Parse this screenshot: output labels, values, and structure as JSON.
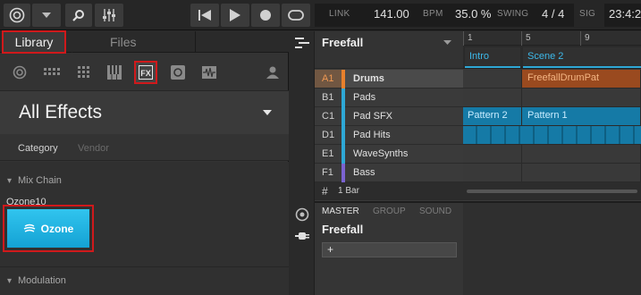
{
  "topbar": {
    "link_label": "LINK",
    "tempo": "141.00",
    "tempo_unit": "BPM",
    "swing": "35.0 %",
    "swing_label": "SWING",
    "signature": "4 / 4",
    "sig_label": "SIG",
    "position": "23:4:2"
  },
  "browser": {
    "tab_library": "Library",
    "tab_files": "Files",
    "selected_type": "All Effects",
    "category_label": "Category",
    "vendor_label": "Vendor",
    "section_mixchain": "Mix Chain",
    "plugin_label": "Ozone10",
    "plugin_tile": "Ozone",
    "section_modulation": "Modulation"
  },
  "arranger": {
    "project": "Freefall",
    "ruler": [
      "1",
      "5",
      "9"
    ],
    "scenes": [
      "Intro",
      "Scene 2"
    ],
    "groups": [
      {
        "letter": "A1",
        "name": "Drums",
        "color": "#e8802c"
      },
      {
        "letter": "B1",
        "name": "Pads",
        "color": "#2ea8d6"
      },
      {
        "letter": "C1",
        "name": "Pad SFX",
        "color": "#2ea8d6"
      },
      {
        "letter": "D1",
        "name": "Pad Hits",
        "color": "#2ea8d6"
      },
      {
        "letter": "E1",
        "name": "WaveSynths",
        "color": "#2ea8d6"
      },
      {
        "letter": "F1",
        "name": "Bass",
        "color": "#7b63d1"
      }
    ],
    "patterns": {
      "drums": "FreefallDrumPat",
      "pad_sfx_1": "Pattern 2",
      "pad_sfx_2": "Pattern 1"
    },
    "length_label": "1 Bar"
  },
  "mixer": {
    "tab_master": "MASTER",
    "tab_group": "GROUP",
    "tab_sound": "SOUND",
    "title": "Freefall",
    "add_label": "+"
  }
}
